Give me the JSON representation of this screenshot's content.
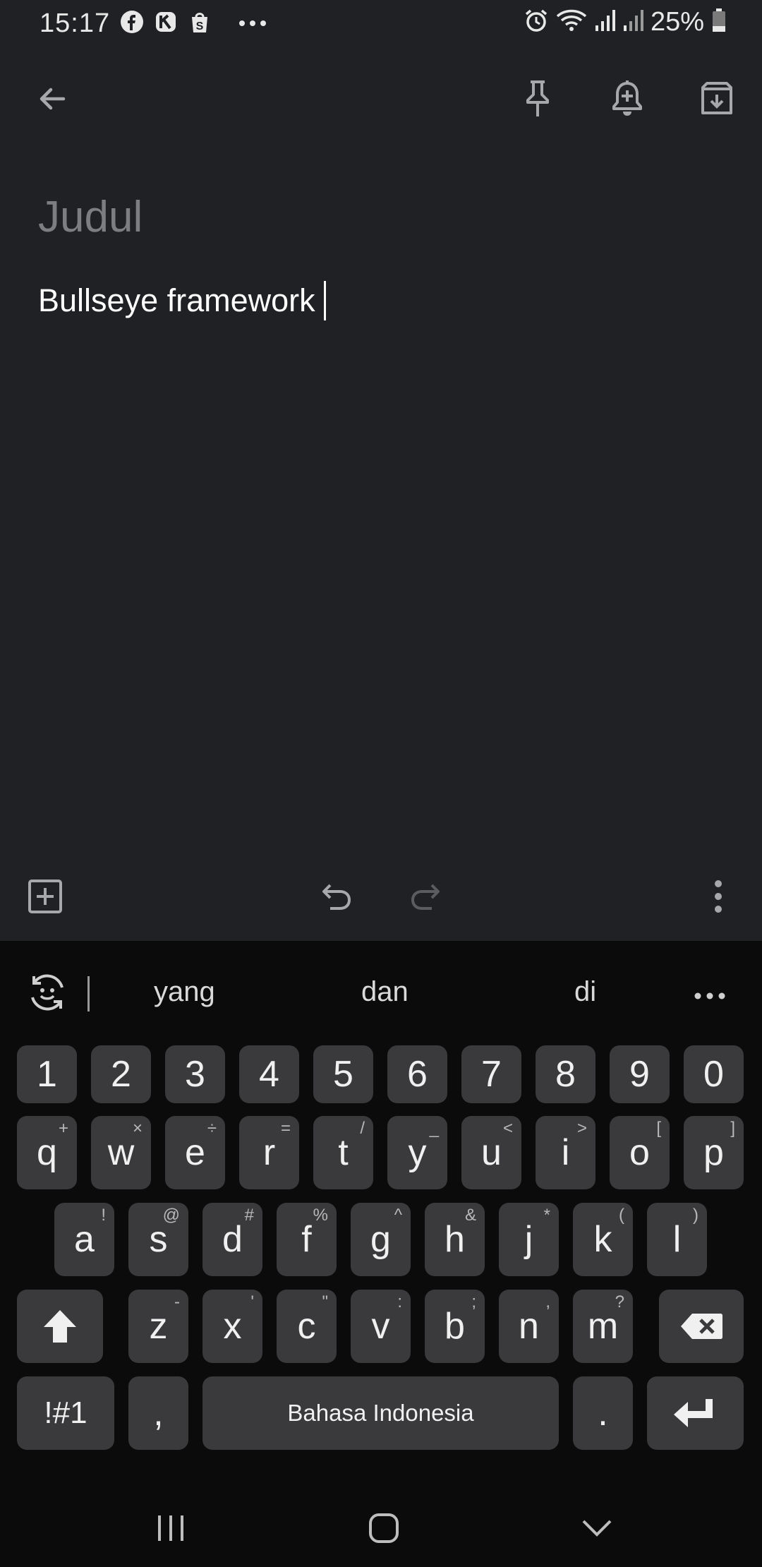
{
  "status_bar": {
    "time": "15:17",
    "battery": "25%",
    "notification_icons": [
      "facebook-icon",
      "app-icon",
      "shopping-bag-icon",
      "more-dots-icon"
    ],
    "system_icons": [
      "alarm-icon",
      "wifi-icon",
      "signal-icon",
      "signal-icon-2",
      "battery-icon"
    ]
  },
  "toolbar": {
    "back": "back-arrow-icon",
    "pin": "pin-icon",
    "reminder": "reminder-bell-icon",
    "archive": "archive-icon"
  },
  "note": {
    "title_placeholder": "Judul",
    "body_text": "Bullseye framework"
  },
  "bottom_toolbar": {
    "add": "add-box-icon",
    "undo": "undo-icon",
    "redo": "redo-icon",
    "more": "more-vert-icon"
  },
  "keyboard": {
    "suggestions": [
      "yang",
      "dan",
      "di"
    ],
    "number_row": [
      "1",
      "2",
      "3",
      "4",
      "5",
      "6",
      "7",
      "8",
      "9",
      "0"
    ],
    "row1": [
      {
        "main": "q",
        "sub": "+"
      },
      {
        "main": "w",
        "sub": "×"
      },
      {
        "main": "e",
        "sub": "÷"
      },
      {
        "main": "r",
        "sub": "="
      },
      {
        "main": "t",
        "sub": "/"
      },
      {
        "main": "y",
        "sub": "_"
      },
      {
        "main": "u",
        "sub": "<"
      },
      {
        "main": "i",
        "sub": ">"
      },
      {
        "main": "o",
        "sub": "["
      },
      {
        "main": "p",
        "sub": "]"
      }
    ],
    "row2": [
      {
        "main": "a",
        "sub": "!"
      },
      {
        "main": "s",
        "sub": "@"
      },
      {
        "main": "d",
        "sub": "#"
      },
      {
        "main": "f",
        "sub": "%"
      },
      {
        "main": "g",
        "sub": "^"
      },
      {
        "main": "h",
        "sub": "&"
      },
      {
        "main": "j",
        "sub": "*"
      },
      {
        "main": "k",
        "sub": "("
      },
      {
        "main": "l",
        "sub": ")"
      }
    ],
    "row3": [
      {
        "main": "z",
        "sub": "-"
      },
      {
        "main": "x",
        "sub": "'"
      },
      {
        "main": "c",
        "sub": "\""
      },
      {
        "main": "v",
        "sub": ":"
      },
      {
        "main": "b",
        "sub": ";"
      },
      {
        "main": "n",
        "sub": ","
      },
      {
        "main": "m",
        "sub": "?"
      }
    ],
    "symbols_label": "!#1",
    "comma_label": ",",
    "space_label": "Bahasa Indonesia",
    "period_label": "."
  },
  "nav_bar": {
    "recents": "recents-icon",
    "home": "home-icon",
    "back": "hide-keyboard-icon"
  },
  "colors": {
    "background": "#202125",
    "keyboard_bg": "#0b0b0c",
    "key_bg": "#3a3a3c",
    "placeholder_text": "#7c7e82"
  }
}
